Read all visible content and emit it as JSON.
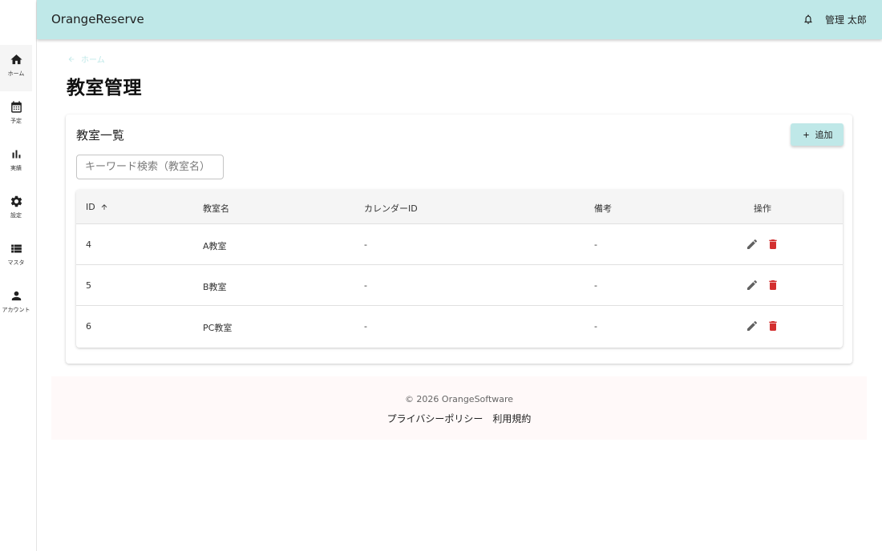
{
  "app": {
    "title": "OrangeReserve",
    "user_name": "管理 太郎"
  },
  "sidebar": {
    "items": [
      {
        "label": "ホーム",
        "icon": "home-icon"
      },
      {
        "label": "予定",
        "icon": "calendar-icon"
      },
      {
        "label": "実績",
        "icon": "bar-chart-icon"
      },
      {
        "label": "設定",
        "icon": "gear-icon"
      },
      {
        "label": "マスタ",
        "icon": "list-icon"
      },
      {
        "label": "アカウント",
        "icon": "person-icon"
      }
    ]
  },
  "breadcrumb": {
    "label": "ホーム"
  },
  "page": {
    "title": "教室管理"
  },
  "card": {
    "title": "教室一覧",
    "add_label": "追加",
    "search_placeholder": "キーワード検索（教室名）"
  },
  "table": {
    "headers": {
      "id": "ID",
      "name": "教室名",
      "calendar_id": "カレンダーID",
      "note": "備考",
      "actions": "操作"
    },
    "rows": [
      {
        "id": "4",
        "name": "A教室",
        "calendar_id": "-",
        "note": "-"
      },
      {
        "id": "5",
        "name": "B教室",
        "calendar_id": "-",
        "note": "-"
      },
      {
        "id": "6",
        "name": "PC教室",
        "calendar_id": "-",
        "note": "-"
      }
    ]
  },
  "footer": {
    "copyright": "© 2026 OrangeSoftware",
    "privacy": "プライバシーポリシー",
    "terms": "利用規約"
  },
  "colors": {
    "header": "#bfe8e8",
    "delete": "#d32f2f",
    "edit": "#616161",
    "footer_bg": "#fff9f9"
  }
}
